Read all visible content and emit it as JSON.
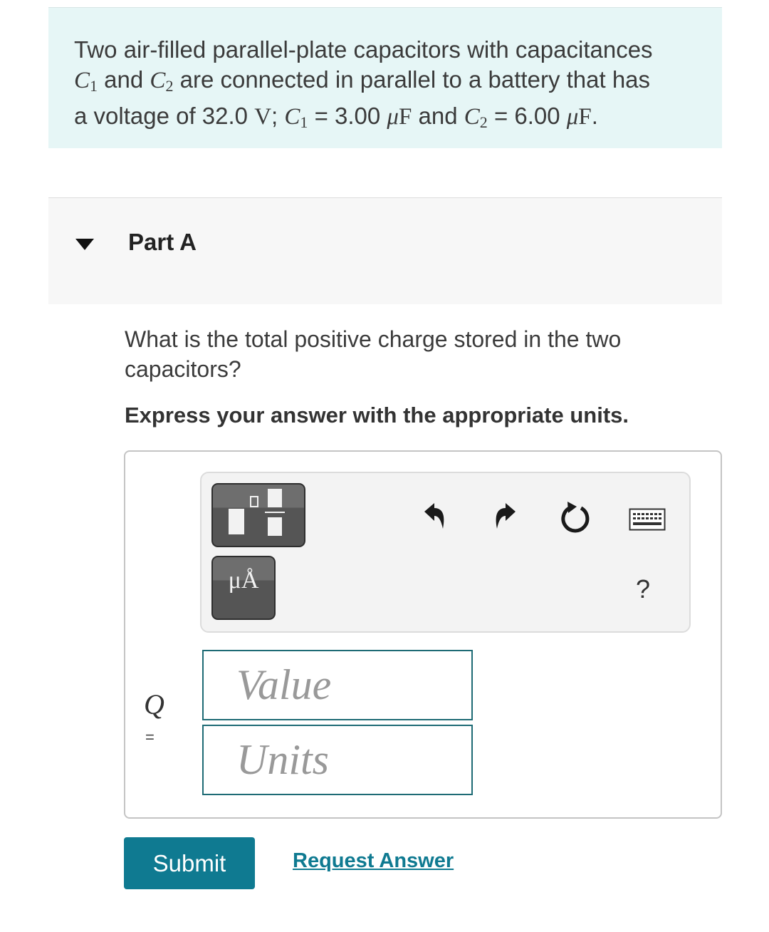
{
  "problem": {
    "s1": "Two air-filled parallel-plate capacitors with capacitances",
    "c1": "C",
    "c1_sub": "1",
    "s2": " and ",
    "c2": "C",
    "c2_sub": "2",
    "s3": " are connected in parallel to a battery that has",
    "s4": "a voltage of 32.0 ",
    "volt_unit": "V",
    "s5": "; ",
    "c1b": "C",
    "c1b_sub": "1",
    "s6": " = 3.00 ",
    "mu1": "μ",
    "f1": "F",
    "s7": " and ",
    "c2b": "C",
    "c2b_sub": "2",
    "s8": " = 6.00 ",
    "mu2": "μ",
    "f2": "F",
    "s9": "."
  },
  "part": {
    "label": "Part A",
    "toggle_icon": "caret-down-icon"
  },
  "question": "What is the total positive charge stored in the two capacitors?",
  "instruction": "Express your answer with the appropriate units.",
  "toolbar": {
    "templates_icon": "templates-icon",
    "units_symbol": "μÅ",
    "undo_icon": "undo-icon",
    "redo_icon": "redo-icon",
    "reset_icon": "reset-icon",
    "keyboard_icon": "keyboard-icon",
    "help_label": "?"
  },
  "answer": {
    "variable": "Q",
    "equals": "=",
    "value_placeholder": "Value",
    "units_placeholder": "Units"
  },
  "buttons": {
    "submit": "Submit",
    "request_answer": "Request Answer"
  },
  "colors": {
    "accent": "#0f7a91",
    "problem_bg": "#e6f6f6",
    "field_border": "#1e6b75"
  }
}
